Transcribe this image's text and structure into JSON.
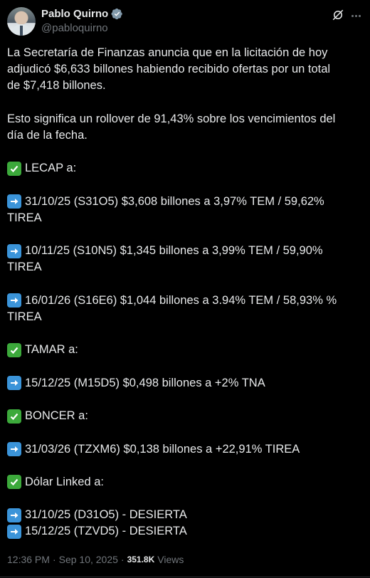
{
  "author": {
    "name": "Pablo Quirno",
    "handle": "@pabloquirno"
  },
  "colors": {
    "background": "#000000",
    "text": "#e7e9ea",
    "muted": "#71767b",
    "verified_badge": "#829aab",
    "check_emoji": "#3ca93b",
    "arrow_emoji": "#3b94d9"
  },
  "icons": {
    "verified": "verified-badge-icon",
    "grok": "grok-icon",
    "more": "more-options-icon",
    "check": "check-mark-button-emoji",
    "arrow": "right-arrow-emoji"
  },
  "tweet": {
    "line1": "La Secretaría de Finanzas anuncia que en la licitación de hoy",
    "line2": "adjudicó $6,633 billones habiendo recibido ofertas por un total",
    "line3": "de $7,418 billones.",
    "line4": "Esto significa un rollover de 91,43% sobre los vencimientos del",
    "line5": "día de la fecha.",
    "lecap_header": "LECAP a:",
    "lecap_1a": "31/10/25 (S31O5) $3,608 billones a 3,97% TEM / 59,62%",
    "lecap_1b": "TIREA",
    "lecap_2a": "10/11/25 (S10N5) $1,345 billones a 3,99% TEM / 59,90%",
    "lecap_2b": "TIREA",
    "lecap_3a": "16/01/26 (S16E6) $1,044 billones a  3.94% TEM / 58,93% %",
    "lecap_3b": "TIREA",
    "tamar_header": "TAMAR a:",
    "tamar_1": "15/12/25 (M15D5) $0,498 billones a +2% TNA",
    "boncer_header": "BONCER a:",
    "boncer_1": "31/03/26 (TZXM6) $0,138 billones a +22,91% TIREA",
    "dolar_header": "Dólar Linked a:",
    "dolar_1": "31/10/25 (D31O5) - DESIERTA",
    "dolar_2": "15/12/25 (TZVD5) - DESIERTA"
  },
  "meta": {
    "time": "12:36 PM",
    "separator": "·",
    "date": "Sep 10, 2025",
    "separator2": "·",
    "views_count": "351.8K",
    "views_label": "Views"
  }
}
